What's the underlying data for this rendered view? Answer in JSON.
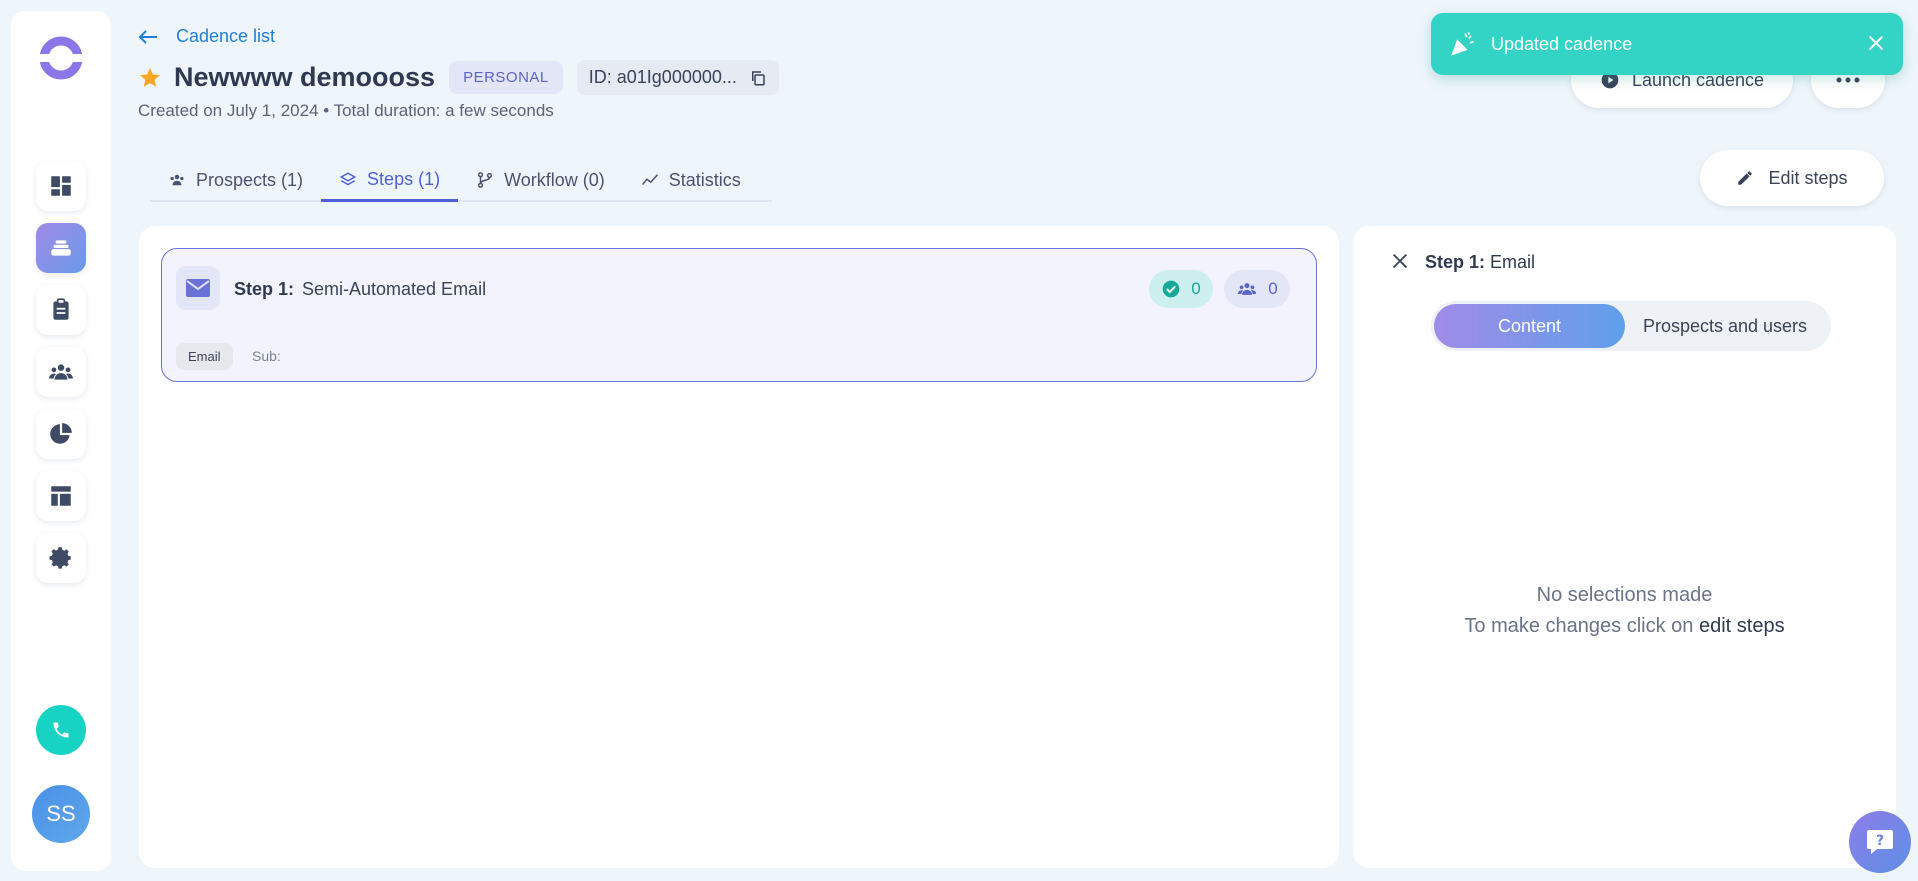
{
  "header": {
    "back_label": "Cadence list",
    "title": "Newwww demoooss",
    "badge": "PERSONAL",
    "id_text": "ID: a01Ig000000...",
    "meta": "Created on July 1, 2024 • Total duration: a few seconds",
    "launch_label": "Launch cadence"
  },
  "toast": {
    "message": "Updated cadence"
  },
  "tabs": [
    {
      "label": "Prospects (1)",
      "icon": "people-icon"
    },
    {
      "label": "Steps (1)",
      "icon": "layers-icon",
      "active": true
    },
    {
      "label": "Workflow (0)",
      "icon": "workflow-icon"
    },
    {
      "label": "Statistics",
      "icon": "chart-line-icon"
    }
  ],
  "edit_steps_label": "Edit steps",
  "step": {
    "label": "Step 1:",
    "name": "Semi-Automated Email",
    "done_count": "0",
    "people_count": "0",
    "type": "Email",
    "sub": "Sub:"
  },
  "detail": {
    "title_label": "Step 1:",
    "title_value": "Email",
    "seg_content": "Content",
    "seg_prospects": "Prospects and users",
    "empty_line1": "No selections made",
    "empty_line2_prefix": "To make changes click on",
    "empty_line2_link": "edit steps"
  },
  "sidebar": {
    "avatar_initials": "SS",
    "items": [
      "dashboard-icon",
      "cadence-icon",
      "tasks-icon",
      "people-icon",
      "reports-icon",
      "templates-icon",
      "settings-icon"
    ]
  },
  "colors": {
    "accent": "#4f5fd6",
    "toast": "#33d4c5",
    "link": "#1f7fd6",
    "star": "#f5a623"
  }
}
